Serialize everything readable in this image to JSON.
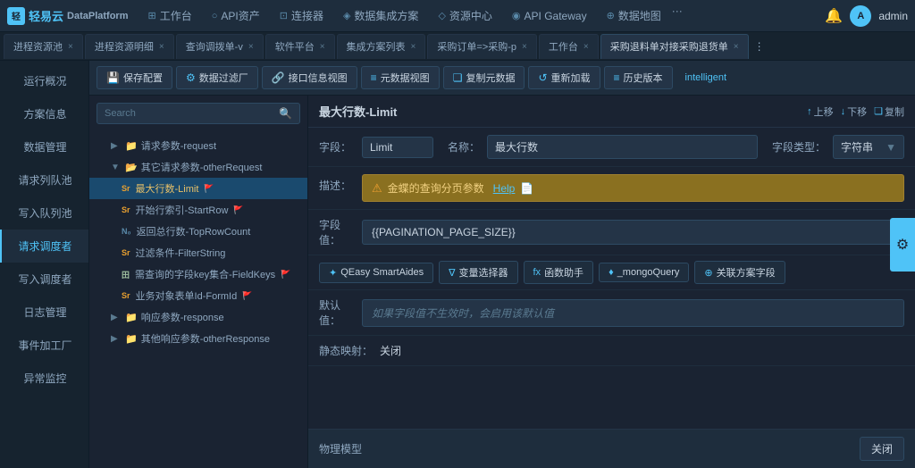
{
  "topnav": {
    "logo_text": "轻易云",
    "logo_sub": "DataPlatform",
    "nav_items": [
      {
        "label": "工作台",
        "icon": "⊞"
      },
      {
        "label": "API资产",
        "icon": "○"
      },
      {
        "label": "连接器",
        "icon": "⊡"
      },
      {
        "label": "数据集成方案",
        "icon": "◈"
      },
      {
        "label": "资源中心",
        "icon": "◇"
      },
      {
        "label": "API Gateway",
        "icon": "◉"
      },
      {
        "label": "数据地图",
        "icon": "⊕"
      }
    ],
    "more": "···",
    "admin": "admin"
  },
  "tabs": [
    {
      "label": "进程资源池",
      "closable": true
    },
    {
      "label": "进程资源明细",
      "closable": true
    },
    {
      "label": "查询调拨单-v",
      "closable": true
    },
    {
      "label": "软件平台",
      "closable": true
    },
    {
      "label": "集成方案列表",
      "closable": true
    },
    {
      "label": "采购订单=>采购-p",
      "closable": true
    },
    {
      "label": "工作台",
      "closable": true
    },
    {
      "label": "采购退料单对接采购退货单",
      "closable": true,
      "active": true
    }
  ],
  "toolbar": {
    "buttons": [
      {
        "label": "保存配置",
        "icon": "💾"
      },
      {
        "label": "数据过滤厂",
        "icon": "⚙"
      },
      {
        "label": "接口信息视图",
        "icon": "🔗"
      },
      {
        "label": "元数据视图",
        "icon": "≡"
      },
      {
        "label": "复制元数据",
        "icon": "❏"
      },
      {
        "label": "重新加载",
        "icon": "↺"
      },
      {
        "label": "历史版本",
        "icon": "≡"
      }
    ],
    "intelligent": "intelligent"
  },
  "sidebar": {
    "items": [
      {
        "label": "运行概况",
        "active": false
      },
      {
        "label": "方案信息",
        "active": false
      },
      {
        "label": "数据管理",
        "active": false
      },
      {
        "label": "请求列队池",
        "active": false
      },
      {
        "label": "写入队列池",
        "active": false
      },
      {
        "label": "请求调度者",
        "active": true
      },
      {
        "label": "写入调度者",
        "active": false
      },
      {
        "label": "日志管理",
        "active": false
      },
      {
        "label": "事件加工厂",
        "active": false
      },
      {
        "label": "异常监控",
        "active": false
      }
    ]
  },
  "search": {
    "placeholder": "Search"
  },
  "tree": {
    "items": [
      {
        "type": "folder",
        "label": "请求参数-request",
        "indent": 1,
        "toggle": "▶",
        "badge": ""
      },
      {
        "type": "folder",
        "label": "其它请求参数-otherRequest",
        "indent": 1,
        "toggle": "▼",
        "badge": ""
      },
      {
        "type": "file",
        "label": "最大行数-Limit",
        "indent": 3,
        "badge_type": "Sr",
        "selected": true,
        "flag": true
      },
      {
        "type": "file",
        "label": "开始行索引-StartRow",
        "indent": 3,
        "badge_type": "Sr",
        "flag": true
      },
      {
        "type": "file",
        "label": "返回总行数-TopRowCount",
        "indent": 3,
        "badge_type": "Nr"
      },
      {
        "type": "file",
        "label": "过滤条件-FilterString",
        "indent": 3,
        "badge_type": "Sr"
      },
      {
        "type": "file",
        "label": "需查询的字段key集合-FieldKeys",
        "indent": 3,
        "badge_type": "田",
        "flag": true
      },
      {
        "type": "file",
        "label": "业务对象表单Id-FormId",
        "indent": 3,
        "badge_type": "Sr",
        "flag": true
      },
      {
        "type": "folder",
        "label": "响应参数-response",
        "indent": 1,
        "toggle": "▶"
      },
      {
        "type": "folder",
        "label": "其他响应参数-otherResponse",
        "indent": 1,
        "toggle": "▶"
      }
    ]
  },
  "detail": {
    "title": "最大行数-Limit",
    "actions": [
      {
        "label": "上移",
        "icon": "↑"
      },
      {
        "label": "下移",
        "icon": "↓"
      },
      {
        "label": "复制",
        "icon": "❏"
      }
    ],
    "field_label": "字段：",
    "field_value": "Limit",
    "name_label": "名称：",
    "name_value": "最大行数",
    "type_label": "字段类型：",
    "type_value": "字符串",
    "desc_label": "描述：",
    "desc_value": "金蝶的查询分页参数",
    "desc_help": "Help",
    "value_label": "字段值：",
    "value_value": "{{PAGINATION_PAGE_SIZE}}",
    "tools": [
      {
        "label": "QEasy SmartAides",
        "icon": "✦"
      },
      {
        "label": "变量选择器",
        "icon": "∇"
      },
      {
        "label": "函数助手",
        "icon": "fx"
      },
      {
        "label": "_mongoQuery",
        "icon": "♦"
      },
      {
        "label": "关联方案字段",
        "icon": "⊕"
      }
    ],
    "default_label": "默认值：",
    "default_placeholder": "如果字段值不生效时，会启用该默认值",
    "static_label": "静态映射：",
    "static_value": "关闭",
    "physical_label": "物理模型",
    "close_label": "关闭"
  }
}
